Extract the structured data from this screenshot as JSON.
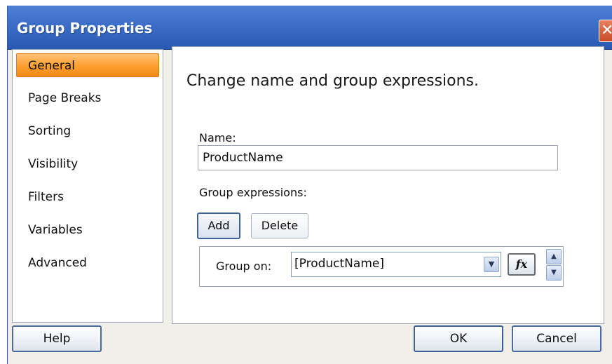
{
  "window": {
    "title": "Group Properties",
    "close_glyph": "✕"
  },
  "nav": {
    "items": [
      {
        "label": "General",
        "selected": true
      },
      {
        "label": "Page Breaks"
      },
      {
        "label": "Sorting"
      },
      {
        "label": "Visibility"
      },
      {
        "label": "Filters"
      },
      {
        "label": "Variables"
      },
      {
        "label": "Advanced"
      }
    ]
  },
  "content": {
    "heading": "Change name and group expressions.",
    "name_label": "Name:",
    "name_value": "ProductName",
    "group_expressions_label": "Group expressions:",
    "add_label": "Add",
    "delete_label": "Delete",
    "group_on_label": "Group on:",
    "group_on_value": "[ProductName]",
    "fx_label": "fx"
  },
  "footer": {
    "help_label": "Help",
    "ok_label": "OK",
    "cancel_label": "Cancel"
  },
  "colors": {
    "titlebar": "#3a6cc6",
    "selected_nav": "#ff9f2e",
    "close_button": "#c84a2a"
  },
  "icons": [
    "close-icon",
    "chevron-down-icon",
    "function-icon",
    "arrow-up-icon",
    "arrow-down-icon"
  ]
}
